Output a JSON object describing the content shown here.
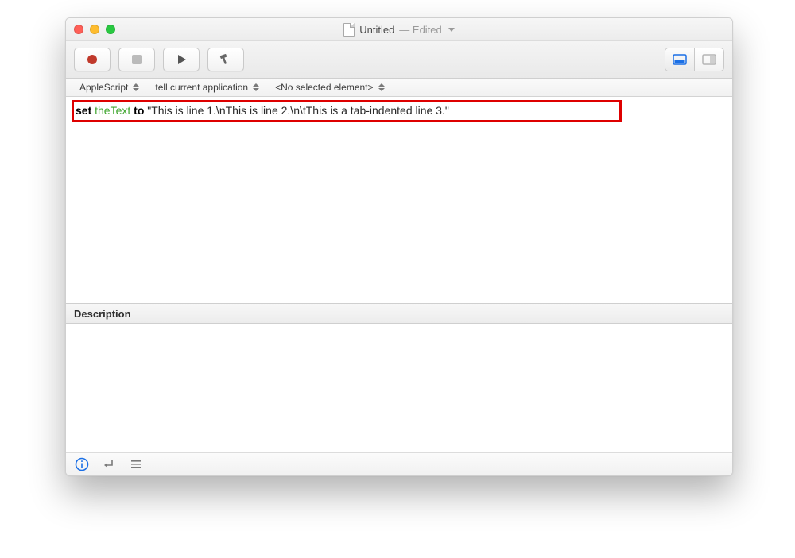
{
  "window": {
    "title": "Untitled",
    "edited_suffix": "— Edited"
  },
  "toolbar": {
    "record_label": "Record",
    "stop_label": "Stop",
    "run_label": "Run",
    "build_label": "Build",
    "view_label": "View"
  },
  "navbar": {
    "language": "AppleScript",
    "context": "tell current application",
    "selection": "<No selected element>"
  },
  "code": {
    "kw_set": "set",
    "var_name": "theText",
    "kw_to": "to",
    "string_literal": "\"This is line 1.\\nThis is line 2.\\n\\tThis is a tab-indented line 3.\""
  },
  "panels": {
    "description_header": "Description"
  },
  "statusbar": {
    "info_label": "Info",
    "enter_label": "Enter",
    "list_label": "List"
  },
  "colors": {
    "highlight_border": "#de0000",
    "variable_green": "#3fa62f"
  }
}
